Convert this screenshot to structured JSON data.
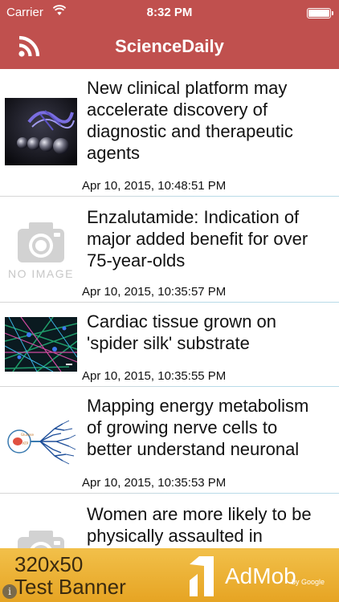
{
  "status_bar": {
    "carrier": "Carrier",
    "time": "8:32 PM",
    "icons": [
      "wifi-icon",
      "battery-icon"
    ]
  },
  "nav_bar": {
    "title": "ScienceDaily",
    "left_icon": "rss-icon",
    "color": "#c0504e"
  },
  "articles": [
    {
      "title_lines": [
        "New clinical platform may",
        "accelerate discovery of",
        "diagnostic and therapeutic",
        "agents"
      ],
      "date": "Apr 10, 2015, 10:48:51 PM",
      "thumbnail": "microscopy-image"
    },
    {
      "title_lines": [
        "Enzalutamide: Indication of",
        "major added benefit for over",
        "75-year-olds"
      ],
      "date": "Apr 10, 2015, 10:35:57 PM",
      "thumbnail": "no-image",
      "no_image_label": "NO IMAGE"
    },
    {
      "title_lines": [
        "Cardiac tissue grown on",
        "'spider silk' substrate"
      ],
      "date": "Apr 10, 2015, 10:35:55 PM",
      "thumbnail": "fluorescent-fibers-image"
    },
    {
      "title_lines": [
        "Mapping energy metabolism",
        "of growing nerve cells to",
        "better understand neuronal"
      ],
      "date": "Apr 10, 2015, 10:35:53 PM",
      "thumbnail": "neuron-diagram-image"
    },
    {
      "title_lines": [
        "Women are more likely to be",
        "physically assaulted in"
      ],
      "date": "",
      "thumbnail": "no-image"
    }
  ],
  "ad_banner": {
    "line1": "320x50",
    "line2": "Test Banner",
    "brand": "AdMob",
    "by": "by Google",
    "info": "i"
  }
}
